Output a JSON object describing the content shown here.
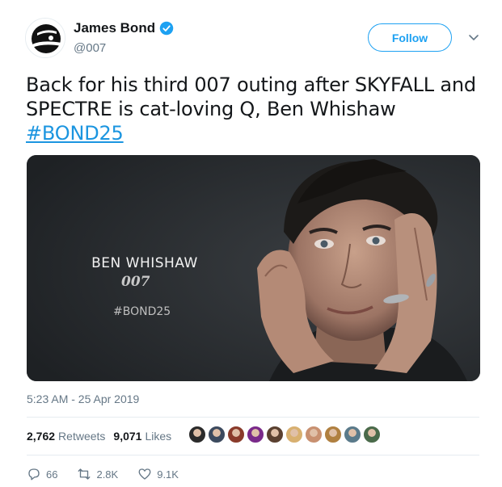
{
  "author": {
    "name": "James Bond",
    "handle": "@007",
    "verified": true
  },
  "follow_label": "Follow",
  "tweet": {
    "text": "Back for his third 007 outing after SKYFALL and SPECTRE is cat-loving Q, Ben Whishaw ",
    "hashtag": "#BOND25"
  },
  "media": {
    "name": "BEN WHISHAW",
    "logo": "007",
    "tag": "#BOND25"
  },
  "timestamp": "5:23 AM - 25 Apr 2019",
  "stats": {
    "retweets": "2,762",
    "retweets_label": "Retweets",
    "likes": "9,071",
    "likes_label": "Likes"
  },
  "liker_avatar_colors": [
    "#2b2b2b",
    "#3c4a5e",
    "#8a3b2b",
    "#7a2a8a",
    "#5a4030",
    "#d8b070",
    "#c89070",
    "#b08040",
    "#5a7a8a",
    "#4a6a4a"
  ],
  "actions": {
    "replies": "66",
    "retweets": "2.8K",
    "likes": "9.1K"
  },
  "colors": {
    "accent": "#1da1f2",
    "link": "#1b95e0",
    "muted": "#657786"
  },
  "icons": [
    "verified-badge-icon",
    "chevron-down-icon",
    "reply-icon",
    "retweet-icon",
    "heart-icon"
  ]
}
